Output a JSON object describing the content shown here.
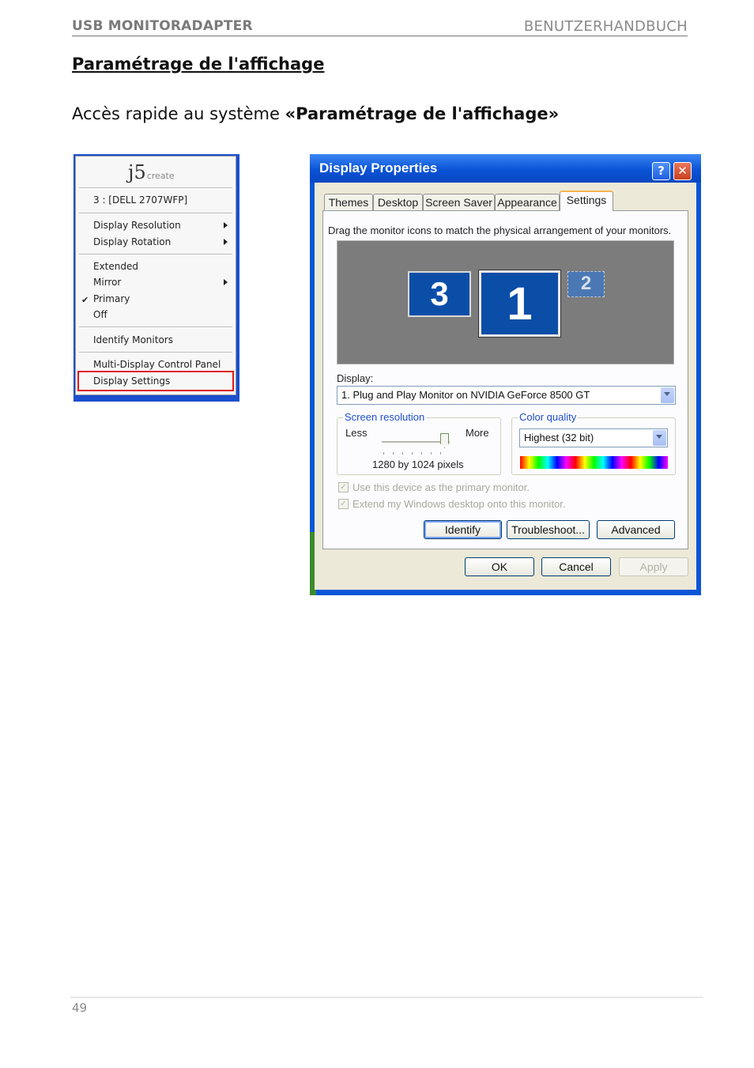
{
  "header": {
    "left": "USB MONITORADAPTER",
    "right": "BENUTZERHANDBUCH"
  },
  "section_title": "Paramétrage de l'affichage",
  "intro": {
    "text": "Accès rapide au système ",
    "bold": "«Paramétrage de l'affichage»"
  },
  "context_menu": {
    "logo_main": "j5",
    "logo_sub": "create",
    "monitor": "3 : [DELL 2707WFP]",
    "items": [
      {
        "label": "Display Resolution",
        "submenu": true
      },
      {
        "label": "Display Rotation",
        "submenu": true
      },
      {
        "label": "Extended"
      },
      {
        "label": "Mirror",
        "submenu": true
      },
      {
        "label": "Primary",
        "checked": true
      },
      {
        "label": "Off"
      },
      {
        "label": "Identify Monitors"
      },
      {
        "label": "Multi-Display Control Panel"
      },
      {
        "label": "Display Settings",
        "highlighted": true
      }
    ]
  },
  "dialog": {
    "title": "Display Properties",
    "help_glyph": "?",
    "close_glyph": "✕",
    "tabs": [
      "Themes",
      "Desktop",
      "Screen Saver",
      "Appearance",
      "Settings"
    ],
    "active_tab": "Settings",
    "instruction": "Drag the monitor icons to match the physical arrangement of your monitors.",
    "monitors": [
      "3",
      "1",
      "2"
    ],
    "display_label": "Display:",
    "display_value": "1. Plug and Play Monitor on NVIDIA GeForce 8500 GT",
    "screen_resolution": {
      "title": "Screen resolution",
      "less": "Less",
      "more": "More",
      "value": "1280 by 1024 pixels",
      "level": 0.95
    },
    "color_quality": {
      "title": "Color quality",
      "value": "Highest (32 bit)"
    },
    "checkboxes": [
      {
        "label": "Use this device as the primary monitor.",
        "checked": true
      },
      {
        "label": "Extend my Windows desktop onto this monitor.",
        "checked": true
      }
    ],
    "check_glyph": "✓",
    "buttons": {
      "identify": "Identify",
      "troubleshoot": "Troubleshoot...",
      "advanced": "Advanced",
      "ok": "OK",
      "cancel": "Cancel",
      "apply": "Apply"
    }
  },
  "page_number": "49"
}
